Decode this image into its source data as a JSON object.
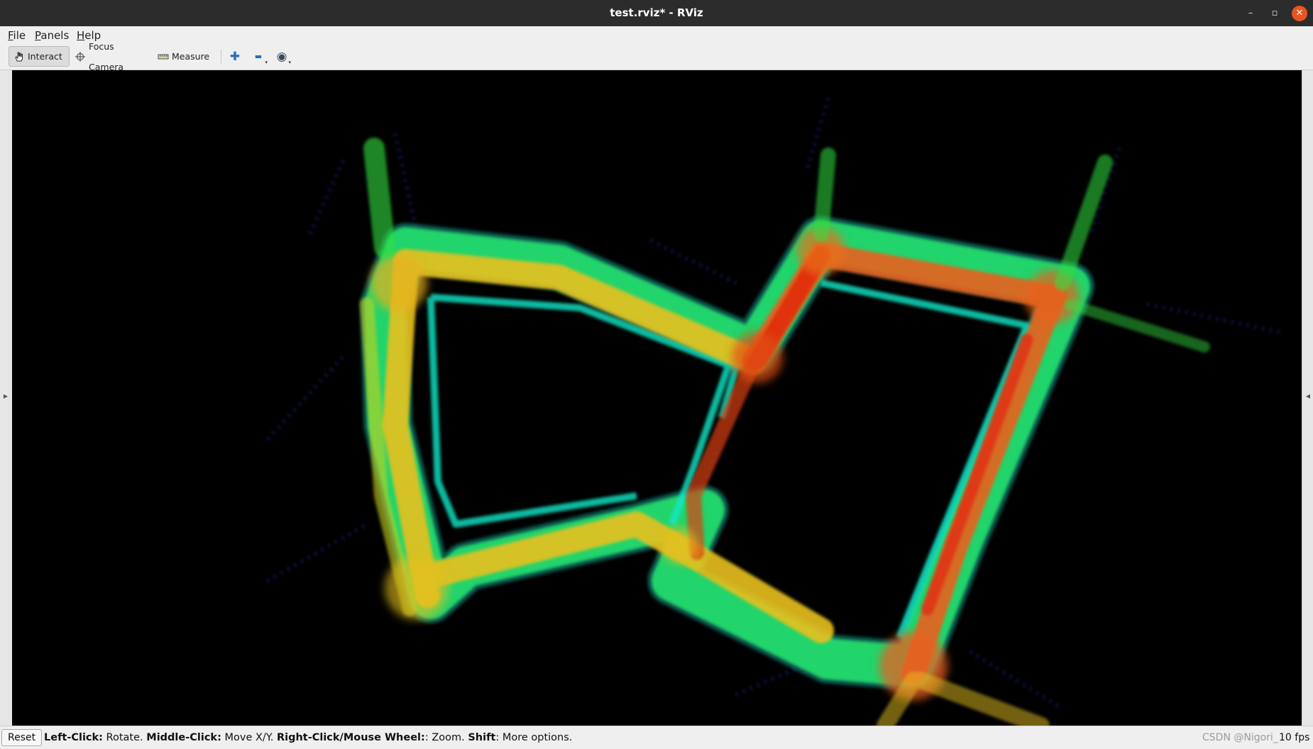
{
  "window": {
    "title": "test.rviz* - RViz",
    "controls": {
      "minimize": "–",
      "maximize": "▫",
      "close": "✕"
    }
  },
  "menubar": {
    "items": [
      {
        "accel": "F",
        "rest": "ile"
      },
      {
        "accel": "P",
        "rest": "anels"
      },
      {
        "accel": "H",
        "rest": "elp"
      }
    ]
  },
  "toolbar": {
    "tools": [
      {
        "label": "Interact",
        "icon": "hand-pointer-icon",
        "active": true
      },
      {
        "label": "Focus Camera",
        "icon": "crosshair-icon",
        "active": false
      },
      {
        "label": "Measure",
        "icon": "ruler-icon",
        "active": false
      }
    ],
    "icon_buttons": [
      {
        "name": "add-tool-icon",
        "glyph": "✚"
      },
      {
        "name": "remove-tool-icon",
        "glyph": "▬"
      },
      {
        "name": "view-eye-icon",
        "glyph": "◉"
      }
    ]
  },
  "viewport": {
    "background": "#000000",
    "content": "point-cloud-map",
    "colors": {
      "high": "#e03010",
      "mid": "#e8c020",
      "low": "#30e040",
      "edge": "#10e8c8",
      "sparse": "#3040e0"
    }
  },
  "statusbar": {
    "reset_label": "Reset",
    "help": [
      {
        "key": "Left-Click:",
        "text": " Rotate. "
      },
      {
        "key": "Middle-Click:",
        "text": " Move X/Y. "
      },
      {
        "key": "Right-Click/Mouse Wheel:",
        "text": ": Zoom. "
      },
      {
        "key": "Shift",
        "text": ": More options."
      }
    ],
    "fps": "10 fps",
    "watermark": "CSDN @Nigori_"
  }
}
